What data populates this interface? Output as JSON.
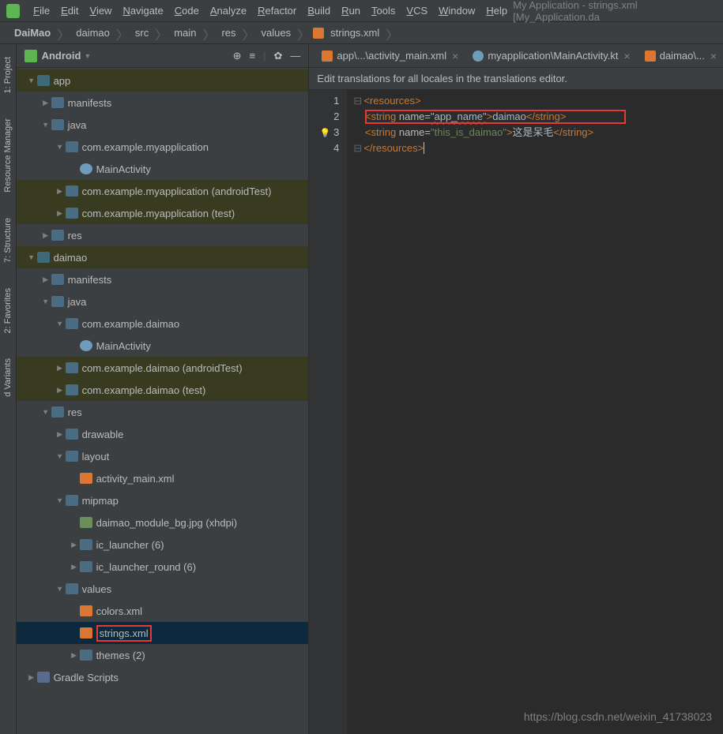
{
  "menu": {
    "items": [
      "File",
      "Edit",
      "View",
      "Navigate",
      "Code",
      "Analyze",
      "Refactor",
      "Build",
      "Run",
      "Tools",
      "VCS",
      "Window",
      "Help"
    ],
    "title": "My Application - strings.xml [My_Application.da"
  },
  "breadcrumb": [
    "DaiMao",
    "daimao",
    "src",
    "main",
    "res",
    "values",
    "strings.xml"
  ],
  "panel": {
    "title": "Android"
  },
  "tree": [
    {
      "d": 0,
      "a": "v",
      "i": "folder-mod",
      "t": "app",
      "hl": true
    },
    {
      "d": 1,
      "a": ">",
      "i": "folder",
      "t": "manifests"
    },
    {
      "d": 1,
      "a": "v",
      "i": "folder",
      "t": "java"
    },
    {
      "d": 2,
      "a": "v",
      "i": "pkg",
      "t": "com.example.myapplication"
    },
    {
      "d": 3,
      "a": "",
      "i": "kt",
      "t": "MainActivity"
    },
    {
      "d": 2,
      "a": ">",
      "i": "pkg",
      "t": "com.example.myapplication (androidTest)",
      "hl": true
    },
    {
      "d": 2,
      "a": ">",
      "i": "pkg",
      "t": "com.example.myapplication (test)",
      "hl": true
    },
    {
      "d": 1,
      "a": ">",
      "i": "folder",
      "t": "res"
    },
    {
      "d": 0,
      "a": "v",
      "i": "folder-mod",
      "t": "daimao",
      "hl": true
    },
    {
      "d": 1,
      "a": ">",
      "i": "folder",
      "t": "manifests"
    },
    {
      "d": 1,
      "a": "v",
      "i": "folder",
      "t": "java"
    },
    {
      "d": 2,
      "a": "v",
      "i": "pkg",
      "t": "com.example.daimao"
    },
    {
      "d": 3,
      "a": "",
      "i": "kt",
      "t": "MainActivity"
    },
    {
      "d": 2,
      "a": ">",
      "i": "pkg",
      "t": "com.example.daimao (androidTest)",
      "hl": true
    },
    {
      "d": 2,
      "a": ">",
      "i": "pkg",
      "t": "com.example.daimao (test)",
      "hl": true
    },
    {
      "d": 1,
      "a": "v",
      "i": "folder",
      "t": "res"
    },
    {
      "d": 2,
      "a": ">",
      "i": "folder",
      "t": "drawable"
    },
    {
      "d": 2,
      "a": "v",
      "i": "folder",
      "t": "layout"
    },
    {
      "d": 3,
      "a": "",
      "i": "xml",
      "t": "activity_main.xml"
    },
    {
      "d": 2,
      "a": "v",
      "i": "folder",
      "t": "mipmap"
    },
    {
      "d": 3,
      "a": "",
      "i": "img",
      "t": "daimao_module_bg.jpg (xhdpi)"
    },
    {
      "d": 3,
      "a": ">",
      "i": "folder",
      "t": "ic_launcher (6)"
    },
    {
      "d": 3,
      "a": ">",
      "i": "folder",
      "t": "ic_launcher_round (6)"
    },
    {
      "d": 2,
      "a": "v",
      "i": "folder",
      "t": "values"
    },
    {
      "d": 3,
      "a": "",
      "i": "xml",
      "t": "colors.xml"
    },
    {
      "d": 3,
      "a": "",
      "i": "xml",
      "t": "strings.xml",
      "sel": true,
      "red": true
    },
    {
      "d": 3,
      "a": ">",
      "i": "folder",
      "t": "themes (2)"
    },
    {
      "d": 0,
      "a": ">",
      "i": "grad",
      "t": "Gradle Scripts"
    }
  ],
  "tabs": [
    {
      "i": "xml",
      "t": "app\\...\\activity_main.xml"
    },
    {
      "i": "kt",
      "t": "myapplication\\MainActivity.kt"
    },
    {
      "i": "xml",
      "t": "daimao\\..."
    }
  ],
  "notice": "Edit translations for all locales in the translations editor.",
  "code": {
    "l1": {
      "tag_open": "<resources>"
    },
    "l2": {
      "open": "<string",
      "attr": " name=",
      "val": "\"app_name\"",
      "close": ">",
      "txt": "daimao",
      "end": "</string>"
    },
    "l3": {
      "open": "<string",
      "attr": " name=",
      "val": "\"this_is_daimao\"",
      "close": ">",
      "txt": "这是呆毛",
      "end": "</string>"
    },
    "l4": {
      "tag_close": "</resources>"
    }
  },
  "sidebars": [
    "1: Project",
    "Resource Manager",
    "7: Structure",
    "2: Favorites",
    "d Variants"
  ],
  "watermark": "https://blog.csdn.net/weixin_41738023"
}
